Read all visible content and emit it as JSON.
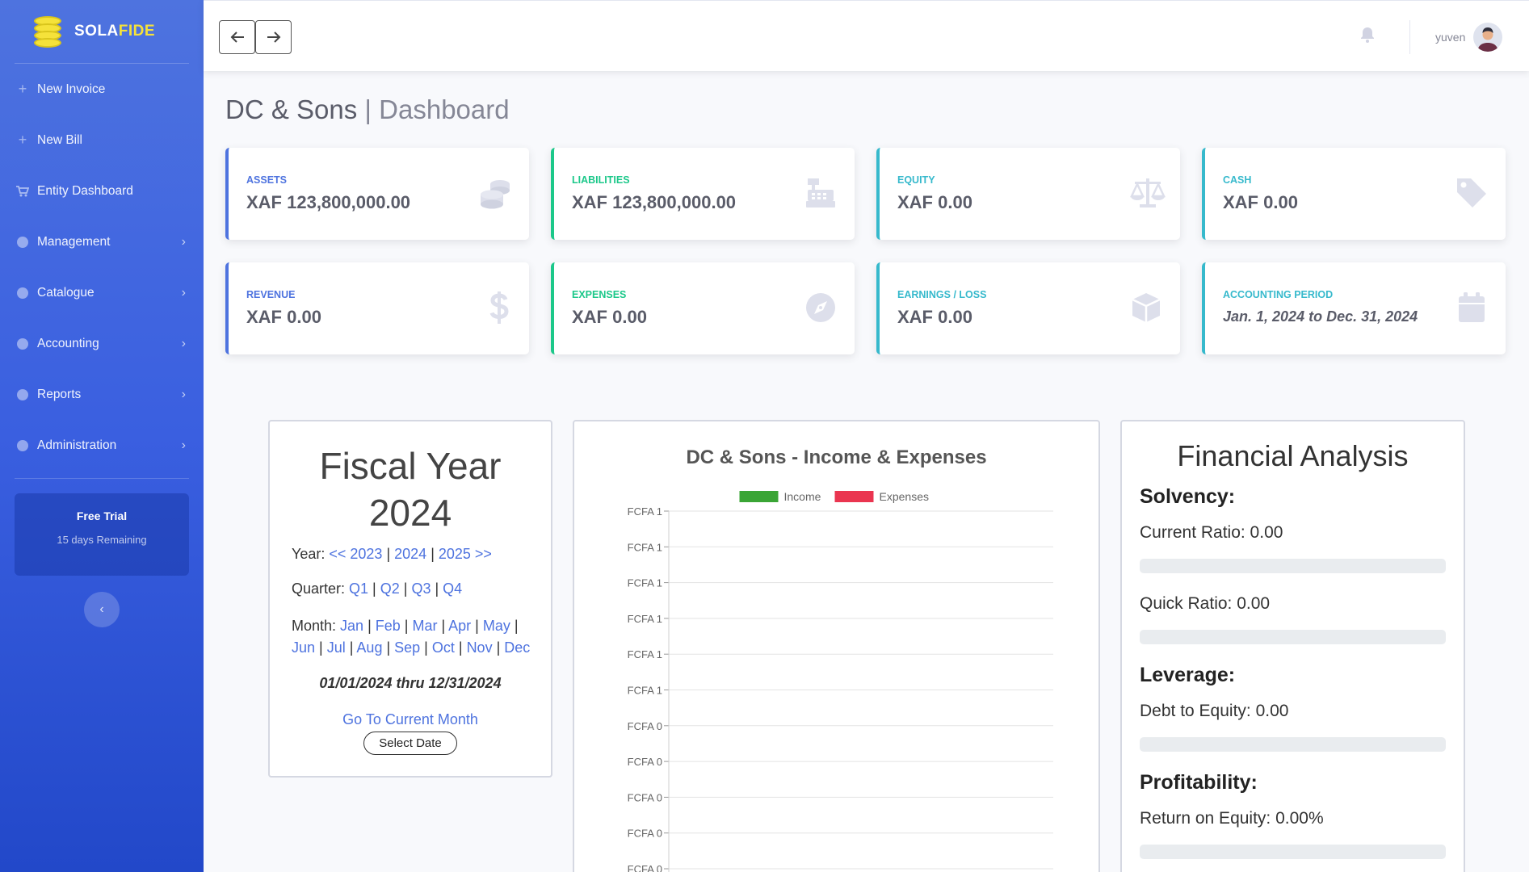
{
  "brand": {
    "name_main": "SOLA",
    "name_accent": "FIDE"
  },
  "sidebar": {
    "items": [
      {
        "label": "New Invoice"
      },
      {
        "label": "New Bill"
      },
      {
        "label": "Entity Dashboard"
      },
      {
        "label": "Management"
      },
      {
        "label": "Catalogue"
      },
      {
        "label": "Accounting"
      },
      {
        "label": "Reports"
      },
      {
        "label": "Administration"
      }
    ],
    "trial": {
      "title": "Free Trial",
      "subtitle": "15 days Remaining"
    }
  },
  "topbar": {
    "user_name": "yuven"
  },
  "page": {
    "entity": "DC & Sons",
    "separator": " | ",
    "section": "Dashboard"
  },
  "cards": [
    {
      "label": "ASSETS",
      "value": "XAF 123,800,000.00",
      "icon": "coins-icon"
    },
    {
      "label": "LIABILITIES",
      "value": "XAF 123,800,000.00",
      "icon": "cash-register-icon"
    },
    {
      "label": "EQUITY",
      "value": "XAF 0.00",
      "icon": "balance-scale-icon"
    },
    {
      "label": "CASH",
      "value": "XAF 0.00",
      "icon": "tag-icon"
    },
    {
      "label": "REVENUE",
      "value": "XAF 0.00",
      "icon": "dollar-icon"
    },
    {
      "label": "EXPENSES",
      "value": "XAF 0.00",
      "icon": "compass-icon"
    },
    {
      "label": "EARNINGS / LOSS",
      "value": "XAF 0.00",
      "icon": "box-icon"
    },
    {
      "label": "ACCOUNTING PERIOD",
      "value": "Jan. 1, 2024 to Dec. 31, 2024",
      "icon": "calendar-icon"
    }
  ],
  "fiscal": {
    "title": "Fiscal Year 2024",
    "year_label": "Year: ",
    "years": [
      "<< 2023",
      "2024",
      "2025 >>"
    ],
    "quarter_label": "Quarter: ",
    "quarters": [
      "Q1",
      "Q2",
      "Q3",
      "Q4"
    ],
    "month_label": "Month: ",
    "months": [
      "Jan",
      "Feb",
      "Mar",
      "Apr",
      "May",
      "Jun",
      "Jul",
      "Aug",
      "Sep",
      "Oct",
      "Nov",
      "Dec"
    ],
    "range": "01/01/2024 thru 12/31/2024",
    "go_current": "Go To Current Month",
    "select_date": "Select Date"
  },
  "chart_data": {
    "type": "bar",
    "title": "DC & Sons - Income & Expenses",
    "series": [
      {
        "name": "Income",
        "color": "#3aa535",
        "values": []
      },
      {
        "name": "Expenses",
        "color": "#ea3550",
        "values": []
      }
    ],
    "y_tick_labels": [
      "FCFA 1",
      "FCFA 1",
      "FCFA 1",
      "FCFA 1",
      "FCFA 1",
      "FCFA 1",
      "FCFA 0",
      "FCFA 0",
      "FCFA 0",
      "FCFA 0",
      "FCFA 0"
    ],
    "grid": true,
    "legend": "top"
  },
  "analysis": {
    "title": "Financial Analysis",
    "sections": [
      {
        "heading": "Solvency:",
        "metrics": [
          {
            "label": "Current Ratio: 0.00",
            "progress": 0
          },
          {
            "label": "Quick Ratio: 0.00",
            "progress": 0
          }
        ]
      },
      {
        "heading": "Leverage:",
        "metrics": [
          {
            "label": "Debt to Equity: 0.00",
            "progress": 0
          }
        ]
      },
      {
        "heading": "Profitability:",
        "metrics": [
          {
            "label": "Return on Equity: 0.00%",
            "progress": 0
          }
        ]
      }
    ]
  }
}
